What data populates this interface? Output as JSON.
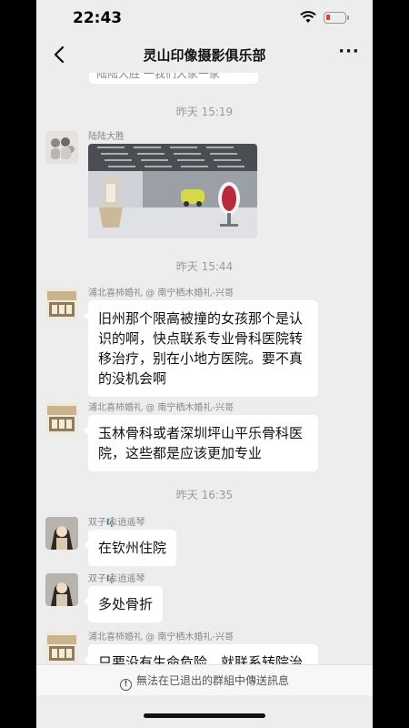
{
  "status": {
    "time": "22:43",
    "battery_level": 0.2,
    "battery_color": "#e03a3a"
  },
  "header": {
    "title": "灵山印像摄影俱乐部"
  },
  "previous_message": {
    "text": "陆陆大胜 一我们大家一家"
  },
  "messages": [
    {
      "type": "timestamp",
      "text": "昨天 15:19"
    },
    {
      "type": "image",
      "sender": "陆陆大胜",
      "avatar": "group-avatar"
    },
    {
      "type": "timestamp",
      "text": "昨天 15:44"
    },
    {
      "type": "text",
      "sender": "浦北喜柿婚礼 @ 南宁栖木婚礼-兴哥",
      "lines": [
        "旧州那个限高被撞的女孩那个是认",
        "识的啊，快点联系专业骨科医院转",
        "移治疗，别在小地方医院。要不真",
        "的没机会啊"
      ]
    },
    {
      "type": "text",
      "sender": "浦北喜柿婚礼 @ 南宁栖木婚礼-兴哥",
      "lines": [
        "玉林骨科或者深圳坪山平乐骨科医",
        "院，这些都是应该更加专业"
      ]
    },
    {
      "type": "timestamp",
      "text": "昨天 16:35"
    },
    {
      "type": "text",
      "sender": "双子🎼逍遥琴",
      "lines": [
        "在钦州住院"
      ]
    },
    {
      "type": "text",
      "sender": "双子🎼逍遥琴",
      "lines": [
        "多处骨折"
      ]
    },
    {
      "type": "text",
      "sender": "浦北喜柿婚礼 @ 南宁栖木婚礼-兴哥",
      "lines": [
        "只要没有生命危险，就联系转院治"
      ]
    }
  ],
  "footer": {
    "text": "無法在已退出的群組中傳送訊息"
  }
}
